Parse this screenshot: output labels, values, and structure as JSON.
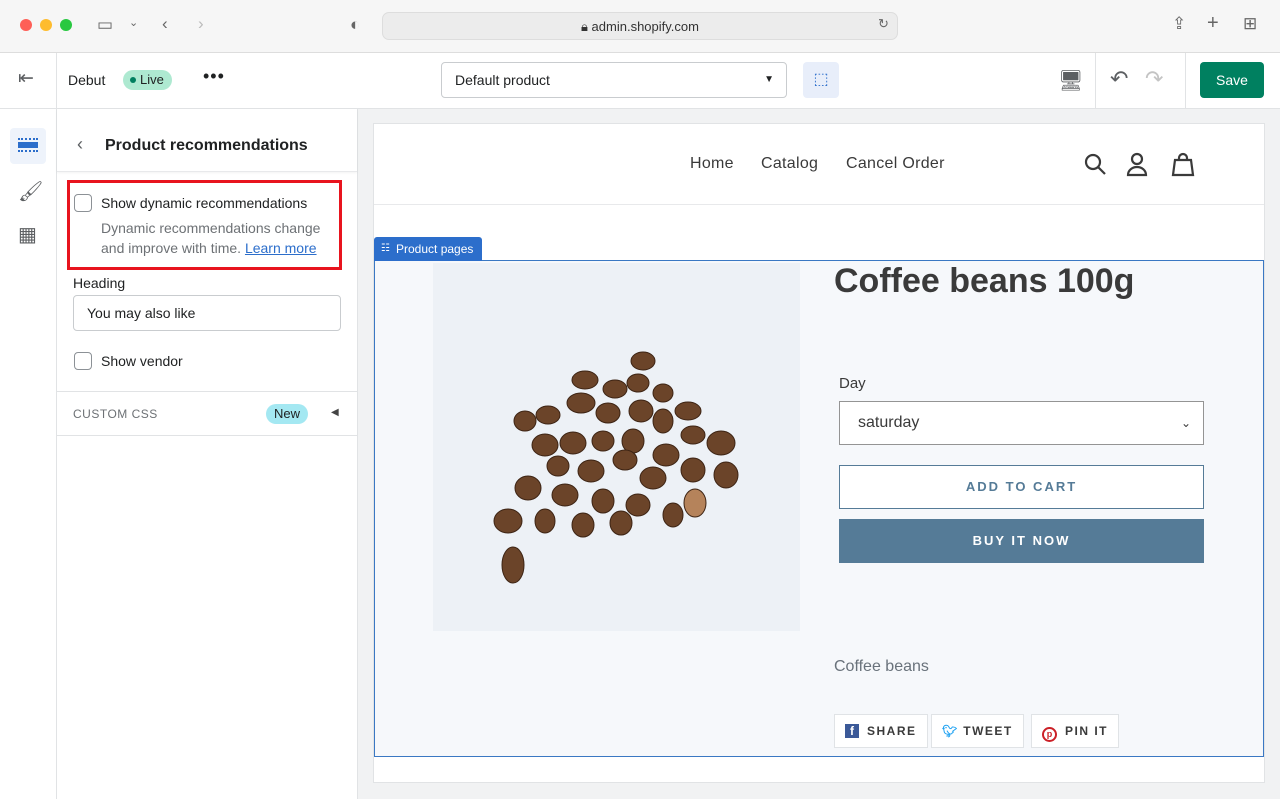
{
  "browser": {
    "url": "admin.shopify.com"
  },
  "topbar": {
    "theme_name": "Debut",
    "status": "Live",
    "template": "Default product",
    "save_label": "Save"
  },
  "panel": {
    "title": "Product recommendations",
    "dynamic": {
      "label": "Show dynamic recommendations",
      "checked": false,
      "help": "Dynamic recommendations change and improve with time.",
      "link": "Learn more"
    },
    "heading_label": "Heading",
    "heading_value": "You may also like",
    "vendor": {
      "label": "Show vendor",
      "checked": false
    },
    "custom_css": {
      "label": "CUSTOM CSS",
      "badge": "New"
    }
  },
  "store": {
    "nav": [
      "Home",
      "Catalog",
      "Cancel Order"
    ],
    "section_tag": "Product pages",
    "product": {
      "title": "Coffee beans 100g",
      "option_label": "Day",
      "option_value": "saturday",
      "add_to_cart": "ADD TO CART",
      "buy_now": "BUY IT NOW",
      "description": "Coffee beans"
    },
    "share": [
      "SHARE",
      "TWEET",
      "PIN IT"
    ]
  },
  "colors": {
    "accent": "#2c6ecb",
    "save": "#008060",
    "highlight": "#e8141e",
    "buy": "#557b97"
  }
}
